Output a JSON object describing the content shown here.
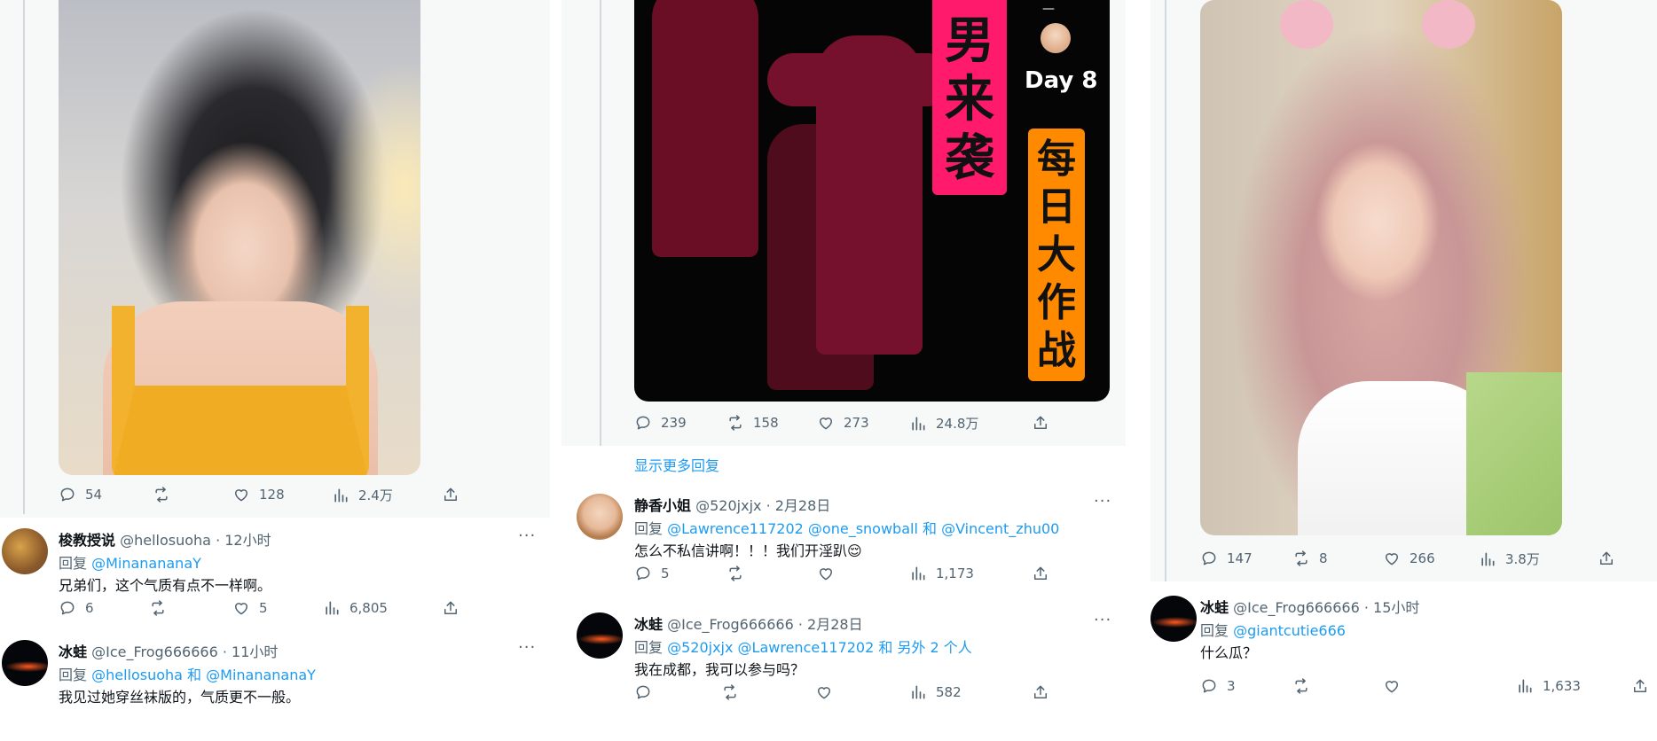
{
  "col1": {
    "post_stats": {
      "replies": "54",
      "retweets": "",
      "likes": "128",
      "views": "2.4万"
    },
    "replies": [
      {
        "name": "梭教授说",
        "handle": "@hellosuoha",
        "time": "· 12小时",
        "to_prefix": "回复 ",
        "to_users": "@MinanananaY",
        "text": "兄弟们，这个气质有点不一样啊。",
        "stats": {
          "replies": "6",
          "retweets": "",
          "likes": "5",
          "views": "6,805"
        }
      },
      {
        "name": "冰蛙",
        "handle": "@Ice_Frog666666",
        "time": "· 11小时",
        "to_prefix": "回复 ",
        "to_users": "@hellosuoha 和 @MinanananaY",
        "text": "我见过她穿丝袜版的，气质更不一般。",
        "stats": {
          "replies": "",
          "retweets": "",
          "likes": "",
          "views": ""
        }
      }
    ]
  },
  "col2": {
    "poster": {
      "title_chars": [
        "男",
        "来",
        "袭"
      ],
      "day": "Day 8",
      "subtitle_chars": [
        "每",
        "日",
        "大",
        "作",
        "战"
      ],
      "dash": "—"
    },
    "post_stats": {
      "replies": "239",
      "retweets": "158",
      "likes": "273",
      "views": "24.8万"
    },
    "show_more": "显示更多回复",
    "replies": [
      {
        "name": "静香小姐",
        "handle": "@520jxjx",
        "time": "· 2月28日",
        "to_prefix": "回复 ",
        "to_users": "@Lawrence117202 @one_snowball 和 @Vincent_zhu00",
        "text": "怎么不私信讲啊！！！我们开淫趴😌",
        "stats": {
          "replies": "5",
          "retweets": "",
          "likes": "",
          "views": "1,173"
        }
      },
      {
        "name": "冰蛙",
        "handle": "@Ice_Frog666666",
        "time": "· 2月28日",
        "to_prefix": "回复 ",
        "to_users": "@520jxjx @Lawrence117202 和 另外 2 个人",
        "text": "我在成都，我可以参与吗？",
        "stats": {
          "replies": "",
          "retweets": "",
          "likes": "",
          "views": "582"
        }
      }
    ]
  },
  "col3": {
    "post_stats": {
      "replies": "147",
      "retweets": "8",
      "likes": "266",
      "views": "3.8万"
    },
    "replies": [
      {
        "name": "冰蛙",
        "handle": "@Ice_Frog666666",
        "time": "· 15小时",
        "to_prefix": "回复 ",
        "to_users": "@giantcutie666",
        "text": "什么瓜？",
        "stats": {
          "replies": "3",
          "retweets": "",
          "likes": "",
          "views": "1,633"
        }
      }
    ]
  },
  "more_icon": "···",
  "icons": [
    "reply-icon",
    "retweet-icon",
    "like-icon",
    "views-icon",
    "share-icon",
    "more-icon"
  ],
  "colors": {
    "link": "#1d9bf0",
    "muted": "#536471",
    "poster_pink": "#ff1a6c",
    "poster_orange": "#ff8a00"
  }
}
